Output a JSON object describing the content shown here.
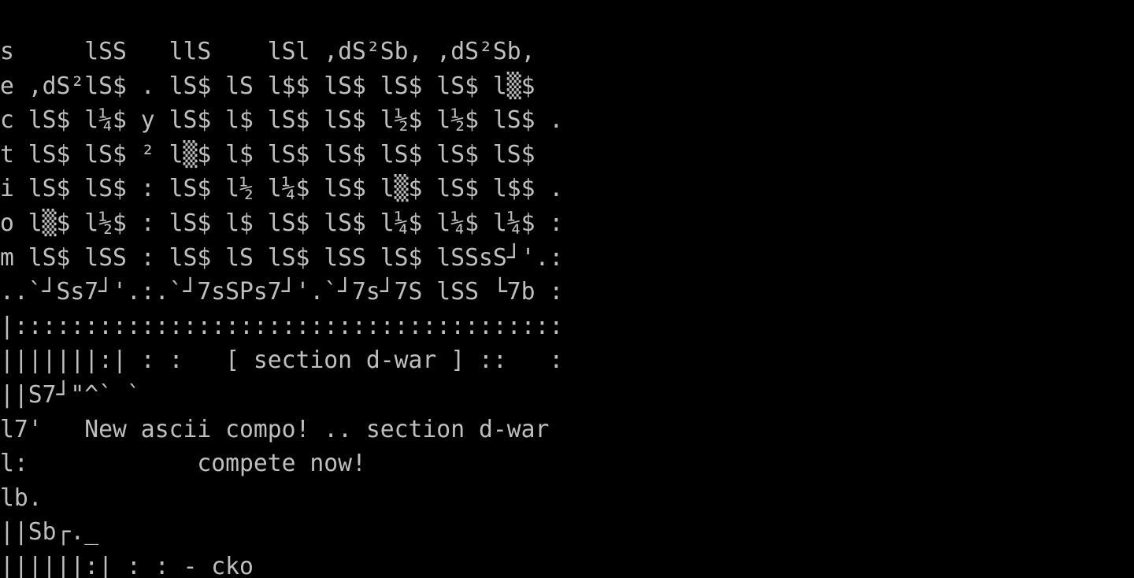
{
  "terminal": {
    "colors": {
      "background": "#000000",
      "text": "#bfbfbf"
    },
    "lines": [
      "s     lSS   llS    lSl ,dS²Sb, ,dS²Sb,",
      "e ,dS²lS$ . lS$ lS l$$ lS$ lS$ lS$ l▒$",
      "c lS$ l¼$ y lS$ l$ lS$ lS$ l½$ l½$ lS$ .",
      "t lS$ lS$ ² l▒$ l$ lS$ lS$ lS$ lS$ lS$",
      "i lS$ lS$ : lS$ l½ l¼$ lS$ l▒$ lS$ l$$ .",
      "o l▒$ l½$ : lS$ l$ lS$ lS$ l¼$ l¼$ l¼$ :",
      "m lS$ lSS : lS$ lS lS$ lSS lS$ lSSsS┘'.:",
      "..`┘Ss7┘'.:.`┘7sSPs7┘'.`┘7s┘7S lSS └7b :",
      "|:::::::::::::::::::::::::::::::::::::::",
      "|||||||:| : :   [ section d-war ] ::   :",
      "||S7┘\"^` `",
      "l7'   New ascii compo! .. section d-war",
      "l:            compete now!",
      "lb.",
      "||Sb┌._",
      "||||||:| : : - cko"
    ]
  }
}
